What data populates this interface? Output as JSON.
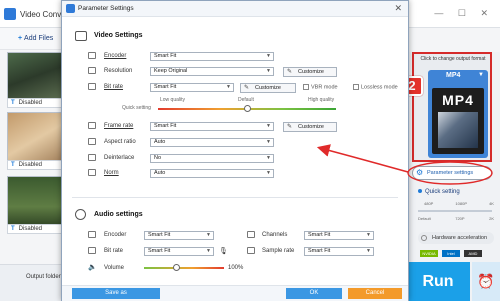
{
  "app": {
    "title": "Video Conve",
    "window_buttons": "— ☐ ✕",
    "add_files": "Add Files",
    "disabled_label": "Disabled",
    "output_folder": "Output folder:"
  },
  "right_panel": {
    "click_change": "Click to change output format",
    "format": "MP4",
    "format_big": "MP4",
    "badge": "2",
    "param_button": "Parameter settings",
    "quick_setting": "Quick setting",
    "qs_top": [
      "480P",
      "1080P",
      "4K"
    ],
    "qs_bottom": [
      "Default",
      "720P",
      "2K"
    ],
    "hw_accel": "Hardware acceleration",
    "gpu": [
      "NVIDIA",
      "Intel",
      "AMD"
    ],
    "run": "Run"
  },
  "dialog": {
    "title": "Parameter Settings",
    "video_settings": "Video Settings",
    "audio_settings": "Audio settings",
    "video": {
      "encoder_label": "Encoder",
      "encoder_value": "Smart Fit",
      "resolution_label": "Resolution",
      "resolution_value": "Keep Original",
      "bitrate_label": "Bit rate",
      "bitrate_value": "Smart Fit",
      "vbr_mode": "VBR mode",
      "lossless_mode": "Lossless mode",
      "quick_setting": "Quick setting",
      "low_quality": "Low quality",
      "default": "Default",
      "high_quality": "High quality",
      "framerate_label": "Frame rate",
      "framerate_value": "Smart Fit",
      "aspect_label": "Aspect ratio",
      "aspect_value": "Auto",
      "deinterlace_label": "Deinterlace",
      "deinterlace_value": "No",
      "norm_label": "Norm",
      "norm_value": "Auto",
      "customize": "Customize"
    },
    "audio": {
      "encoder_label": "Encoder",
      "encoder_value": "Smart Fit",
      "channels_label": "Channels",
      "channels_value": "Smart Fit",
      "bitrate_label": "Bit rate",
      "bitrate_value": "Smart Fit",
      "samplerate_label": "Sample rate",
      "samplerate_value": "Smart Fit",
      "volume_label": "Volume",
      "volume_value": "100%",
      "volume_level": 0.4
    },
    "save_as": "Save as",
    "ok": "OK",
    "cancel": "Cancel"
  },
  "colors": {
    "accent_blue": "#3b97e3",
    "cancel_orange": "#f39a2a",
    "highlight_red": "#d52b2b",
    "run_blue": "#1ba0e8"
  }
}
